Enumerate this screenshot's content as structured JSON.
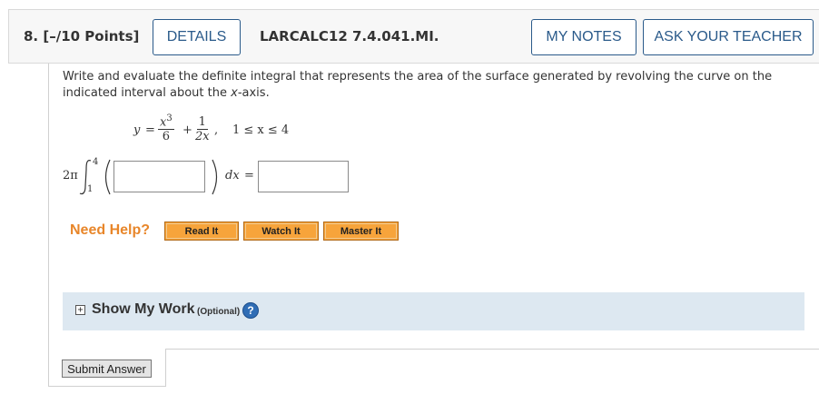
{
  "question": {
    "number_points": "8. [–/10 Points]",
    "reference": "LARCALC12 7.4.041.MI."
  },
  "buttons": {
    "details": "DETAILS",
    "my_notes": "MY NOTES",
    "ask_teacher": "ASK YOUR TEACHER"
  },
  "prompt": {
    "before_var": "Write and evaluate the definite integral that represents the area of the surface generated by revolving the curve on the indicated interval about the ",
    "var": "x",
    "after_var": "-axis."
  },
  "equation": {
    "y": "y",
    "equals": "=",
    "frac1_num_base": "x",
    "frac1_num_exp": "3",
    "frac1_den": "6",
    "plus": "+",
    "frac2_num": "1",
    "frac2_den": "2x",
    "comma": ",",
    "interval": "1 ≤ x ≤ 4"
  },
  "integral": {
    "coefficient": "2π",
    "upper_limit": "4",
    "lower_limit": "1",
    "dx": "dx",
    "equals": "=",
    "integrand_value": "",
    "result_value": ""
  },
  "help": {
    "label": "Need Help?",
    "read": "Read It",
    "watch": "Watch It",
    "master": "Master It"
  },
  "show_my_work": {
    "expand_symbol": "+",
    "title": "Show My Work",
    "optional": "(Optional)",
    "help_symbol": "?"
  },
  "submit": "Submit Answer",
  "colors": {
    "accent_blue": "#2a5a8a",
    "need_help_orange": "#e8862a",
    "button_orange": "#f7a43b",
    "show_work_bg": "#dde8f1"
  }
}
